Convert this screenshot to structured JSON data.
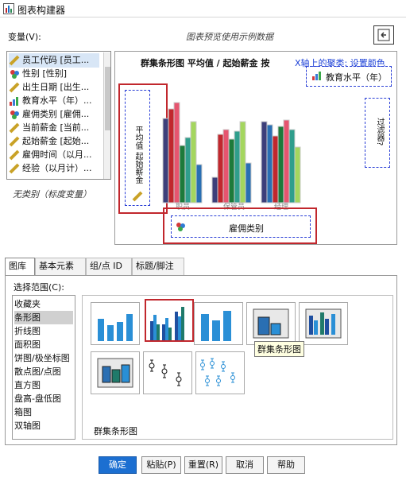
{
  "window": {
    "title": "图表构建器"
  },
  "variables_label": "变量(V):",
  "preview_note": "图表预览使用示例数据",
  "variables": [
    {
      "label": "员工代码 [员工...",
      "icon": "ruler-icon"
    },
    {
      "label": "性别 [性别]",
      "icon": "nominal-icon"
    },
    {
      "label": "出生日期 [出生...",
      "icon": "ruler-icon"
    },
    {
      "label": "教育水平（年）...",
      "icon": "ordinal-icon"
    },
    {
      "label": "雇佣类别 [雇佣...",
      "icon": "nominal-icon"
    },
    {
      "label": "当前薪金 [当前...",
      "icon": "ruler-icon"
    },
    {
      "label": "起始薪金 [起始...",
      "icon": "ruler-icon"
    },
    {
      "label": "雇佣时间（以月...",
      "icon": "ruler-icon"
    },
    {
      "label": "经验（以月计）...",
      "icon": "ruler-icon"
    }
  ],
  "variable_note": "无类别（标度变量）",
  "canvas": {
    "chart_title": "群集条形图 平均值 / 起始薪金 按",
    "link_text": "X轴上的聚类: 设置颜色",
    "legend_label": "教育水平（年）",
    "filter_label": "过滤器?",
    "y_axis_label": "平均值 起始薪金",
    "x_drop_label": "雇佣类别",
    "x_categories": [
      "职员",
      "保管员",
      "经理"
    ]
  },
  "tabs": [
    "图库",
    "基本元素",
    "组/点 ID",
    "标题/脚注"
  ],
  "scope_label": "选择范围(C):",
  "scope_items": [
    "收藏夹",
    "条形图",
    "折线图",
    "面积图",
    "饼图/极坐标图",
    "散点图/点图",
    "直方图",
    "盘高-盘低图",
    "箱图",
    "双轴图"
  ],
  "gallery_tooltip": "群集条形图",
  "gallery_caption": "群集条形图",
  "buttons": {
    "ok": "确定",
    "paste": "粘贴(P)",
    "reset": "重置(R)",
    "cancel": "取消",
    "help": "帮助"
  }
}
